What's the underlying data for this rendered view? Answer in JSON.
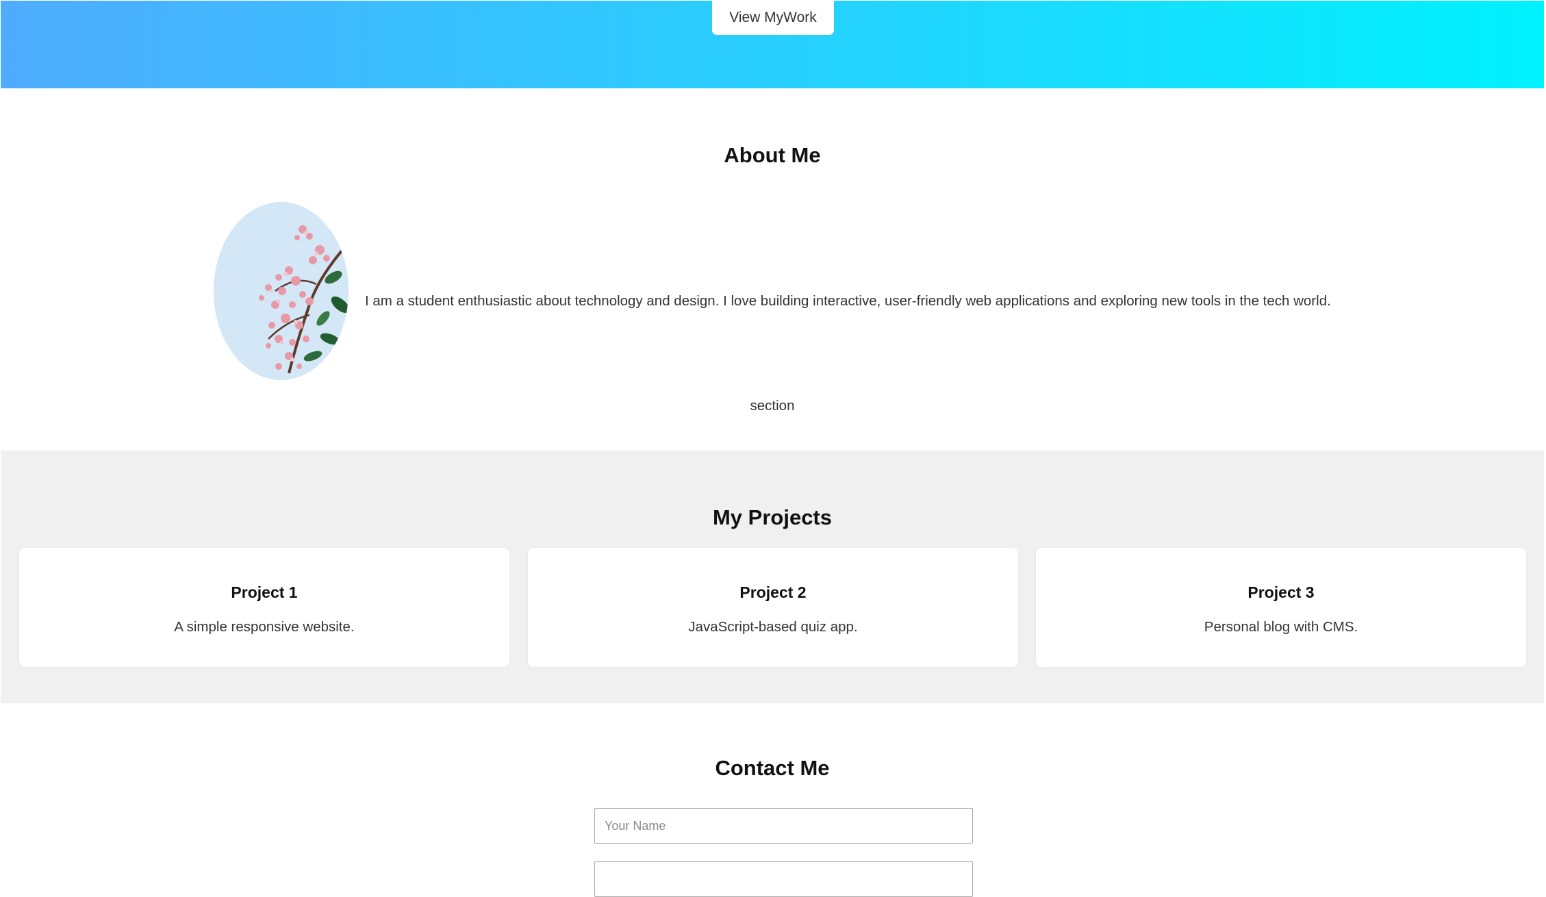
{
  "hero": {
    "button_label": "View MyWork",
    "gradient_start": "#4facfe",
    "gradient_end": "#00f2fe"
  },
  "about": {
    "title": "About Me",
    "image": "profile-flower-photo",
    "text": "I am a student enthusiastic about technology and design. I love building interactive, user-friendly web applications and exploring new tools in the tech world.",
    "footer": "section"
  },
  "projects": {
    "title": "My Projects",
    "background": "#f0f0f0",
    "items": [
      {
        "title": "Project 1",
        "description": "A simple responsive website."
      },
      {
        "title": "Project 2",
        "description": "JavaScript-based quiz app."
      },
      {
        "title": "Project 3",
        "description": "Personal blog with CMS."
      }
    ]
  },
  "contact": {
    "title": "Contact Me",
    "name_placeholder": "Your Name"
  }
}
